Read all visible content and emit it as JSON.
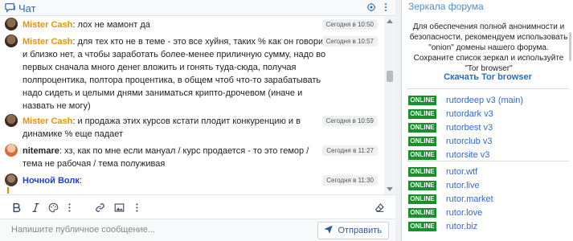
{
  "chat": {
    "title": "Чат",
    "header_icons": [
      "settings-icon",
      "more-vertical-icon"
    ],
    "messages": [
      {
        "author": "Mister Cash",
        "text": ": лох не мамонт да",
        "time": "Сегодня в 10:50",
        "author_color": "#e79300"
      },
      {
        "author": "Mister Cash",
        "text": ": для тех кто не в теме - это все хуйня, таких % как он говорит и близко нет, а чтобы заработать более-менее приличную сумму, надо во первых сначала много денег вложить и гонять туда-сюда, получая полпроцентика, полтора процентика, в общем чтоб что-то зарабатывать надо сидеть и целыми днями заниматься крипто-дрочевом (иначе и назвать не могу)",
        "time": "Сегодня в 10:57",
        "author_color": "#e79300"
      },
      {
        "author": "Mister Cash",
        "text": ": и продажа этих курсов кстати плодит конкуренцию и в динамике % еще падает",
        "time": "Сегодня в 10:59",
        "author_color": "#e79300"
      },
      {
        "author": "nitemare",
        "text": ": хз, как по мне если мануал / курс продается - то это гемор / тема не рабочая / тема полуживая",
        "time": "Сегодня в 11:27",
        "author_color": "#222222"
      },
      {
        "author": "Ночной Волк",
        "text": ":",
        "time": "Сегодня в 11:30",
        "author_color": "#1a3fd6"
      }
    ],
    "toolbar_icons": [
      "bold-icon",
      "italic-icon",
      "palette-icon",
      "more-icon",
      "link-icon",
      "image-icon",
      "more-icon",
      "eraser-icon"
    ],
    "input_placeholder": "Напишите публичное сообщение...",
    "send_label": "Отправить"
  },
  "mirrors": {
    "title": "Зеркала форума",
    "description": "Для обеспечения полной анонимности и безопасности, рекомендуем использовать \"onion\" домены нашего форума. Сохраните список зеркал и используйте \"Tor browser\"",
    "tor_link": "Скачать Tor browser",
    "status_label": "ONLINE",
    "group1": [
      "rutordeep v3 (main)",
      "rutordark v3",
      "rutorbest v3",
      "rutorclub v3",
      "rutorsite v3"
    ],
    "group2": [
      "rutor.wtf",
      "rutor.live",
      "rutor.market",
      "rutor.love",
      "rutor.biz"
    ],
    "status_color": "#1d8e2f",
    "link_color": "#2f6ad3"
  }
}
